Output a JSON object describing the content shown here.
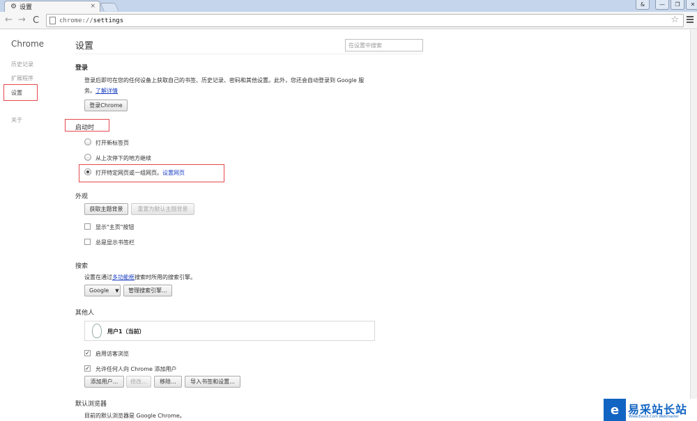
{
  "tab": {
    "title": "设置",
    "close": "×"
  },
  "window": {
    "user": "&",
    "minimize": "—",
    "restore": "❐",
    "close": "✕"
  },
  "toolbar": {
    "back": "←",
    "forward": "→",
    "reload": "C",
    "url_scheme": "chrome://",
    "url_path": "settings",
    "star": "☆"
  },
  "sidebar": {
    "brand": "Chrome",
    "items": [
      {
        "label": "历史记录"
      },
      {
        "label": "扩展程序"
      },
      {
        "label": "设置"
      },
      {
        "label": "关于"
      }
    ]
  },
  "page": {
    "title": "设置",
    "search_placeholder": "在设置中搜索"
  },
  "signin": {
    "title": "登录",
    "desc1": "登录后即可在您的任何设备上获取自己的书签、历史记录、密码和其他设置。此外，您还会自动登录到 Google 服",
    "desc2_prefix": "务。",
    "learn_more": "了解详情",
    "button": "登录Chrome"
  },
  "startup": {
    "title": "启动时",
    "options": [
      {
        "label": "打开新标签页",
        "selected": false
      },
      {
        "label": "从上次停下的地方继续",
        "selected": false
      },
      {
        "label": "打开特定网页或一组网页。",
        "selected": true
      }
    ],
    "set_pages": "设置网页"
  },
  "appearance": {
    "title": "外观",
    "get_themes": "获取主题背景",
    "reset_theme": "重置为默认主题背景",
    "show_home": "显示\"主页\"按钮",
    "show_bookmarks": "总是显示书签栏"
  },
  "search": {
    "title": "搜索",
    "desc_prefix": "设置在通过",
    "omnibox_link": "多功能框",
    "desc_suffix": "搜索时所用的搜索引擎。",
    "engine": "Google",
    "manage": "管理搜索引擎..."
  },
  "people": {
    "title": "其他人",
    "user": "用户1（当前）",
    "guest": "启用访客浏览",
    "anyone_add": "允许任何人向 Chrome 添加用户",
    "add_user": "添加用户...",
    "edit": "修改...",
    "remove": "移除...",
    "import": "导入书签和设置..."
  },
  "default_browser": {
    "title": "默认浏览器",
    "desc": "目前的默认浏览器是 Google Chrome。"
  },
  "watermark": {
    "logo": "e",
    "text": "易采站长站",
    "sub": "Www.Easck.Com Webmaster"
  }
}
